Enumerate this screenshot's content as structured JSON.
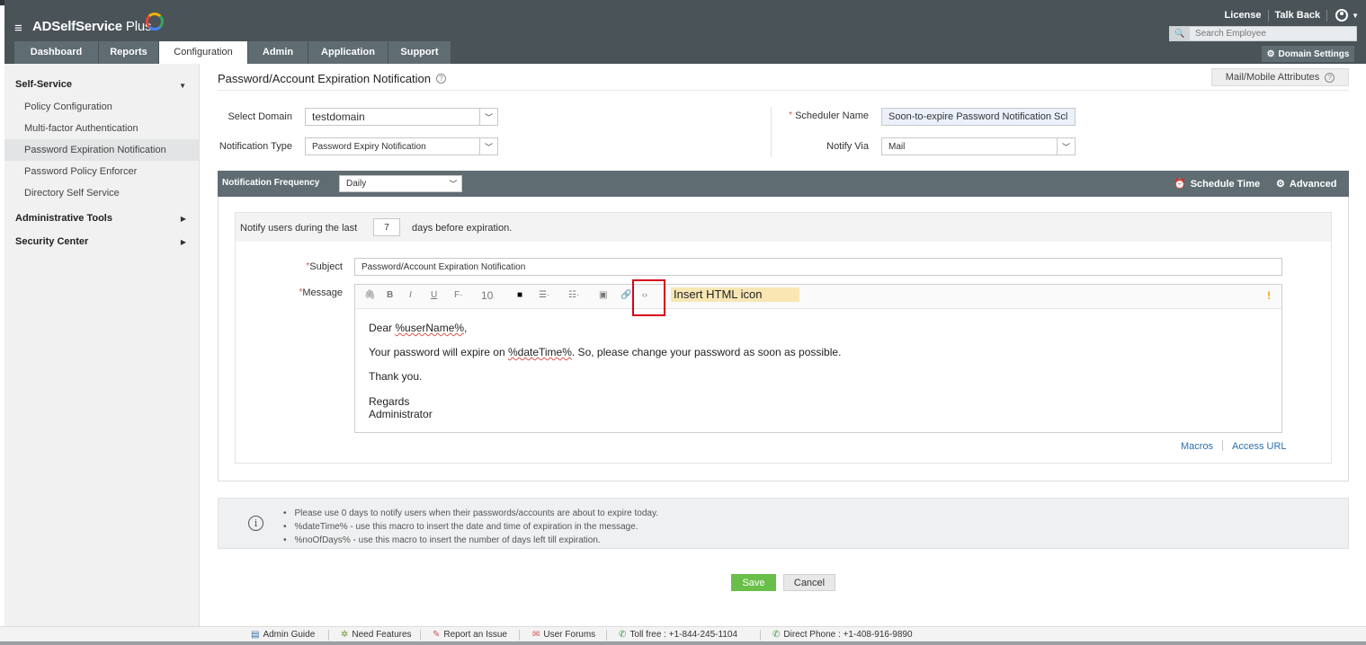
{
  "app": {
    "name_main": "ADSelfService",
    "name_plus": " Plus",
    "menu_icon": "hamburger-icon"
  },
  "topnav": {
    "tabs": [
      "Dashboard",
      "Reports",
      "Configuration",
      "Admin",
      "Application",
      "Support"
    ],
    "active_tab": "Configuration",
    "license": "License",
    "talk_back": "Talk Back",
    "search_placeholder": "Search Employee",
    "domain_settings": "Domain Settings"
  },
  "sidebar": {
    "self_service": "Self-Service",
    "items": [
      "Policy Configuration",
      "Multi-factor Authentication",
      "Password Expiration Notification",
      "Password Policy Enforcer",
      "Directory Self Service"
    ],
    "active_item": "Password Expiration Notification",
    "administrative_tools": "Administrative Tools",
    "security_center": "Security Center"
  },
  "page": {
    "title": "Password/Account Expiration Notification",
    "mail_mobile_attributes": "Mail/Mobile Attributes"
  },
  "form": {
    "select_domain_label": "Select Domain",
    "select_domain_value": "testdomain",
    "notification_type_label": "Notification Type",
    "notification_type_value": "Password Expiry Notification",
    "scheduler_name_label": "Scheduler Name",
    "scheduler_name_value": "Soon-to-expire Password Notification Scl",
    "notify_via_label": "Notify Via",
    "notify_via_value": "Mail"
  },
  "frequency": {
    "label": "Notification Frequency",
    "value": "Daily",
    "schedule_time": "Schedule Time",
    "advanced": "Advanced"
  },
  "notify": {
    "prefix": "Notify users during the last",
    "days": "7",
    "suffix": "days before expiration."
  },
  "message": {
    "subject_label": "Subject",
    "subject_value": "Password/Account Expiration Notification",
    "message_label": "Message",
    "font_size": "10",
    "annotation": "Insert HTML icon",
    "warning_mark": "!",
    "lines": {
      "greeting_prefix": "Dear ",
      "greeting_macro": "%userName%",
      "greeting_suffix": ",",
      "body_prefix": "Your password will expire on ",
      "body_macro": "%dateTime%",
      "body_suffix": ". So, please change your password as soon as possible.",
      "thanks": "Thank you.",
      "regards": "Regards",
      "signature": "Administrator"
    },
    "macros_link": "Macros",
    "access_url_link": "Access URL"
  },
  "info": {
    "notes": [
      "Please use 0 days to notify users when their passwords/accounts are about to expire today.",
      "%dateTime% - use this macro to insert the date and time of expiration in the message.",
      "%noOfDays% - use this macro to insert the number of days left till expiration."
    ]
  },
  "actions": {
    "save": "Save",
    "cancel": "Cancel"
  },
  "footer": {
    "admin_guide": "Admin Guide",
    "need_features": "Need Features",
    "report_issue": "Report an Issue",
    "user_forums": "User Forums",
    "toll_free": "Toll free : +1-844-245-1104",
    "direct_phone": "Direct Phone : +1-408-916-9890"
  },
  "colors": {
    "header_bg": "#4a5358",
    "tab_bg": "#5f6c72",
    "save_green": "#6abf4b",
    "highlight_red": "#d6001c",
    "annotation_bg": "#f8e6b4",
    "link_blue": "#2a6fb0"
  }
}
